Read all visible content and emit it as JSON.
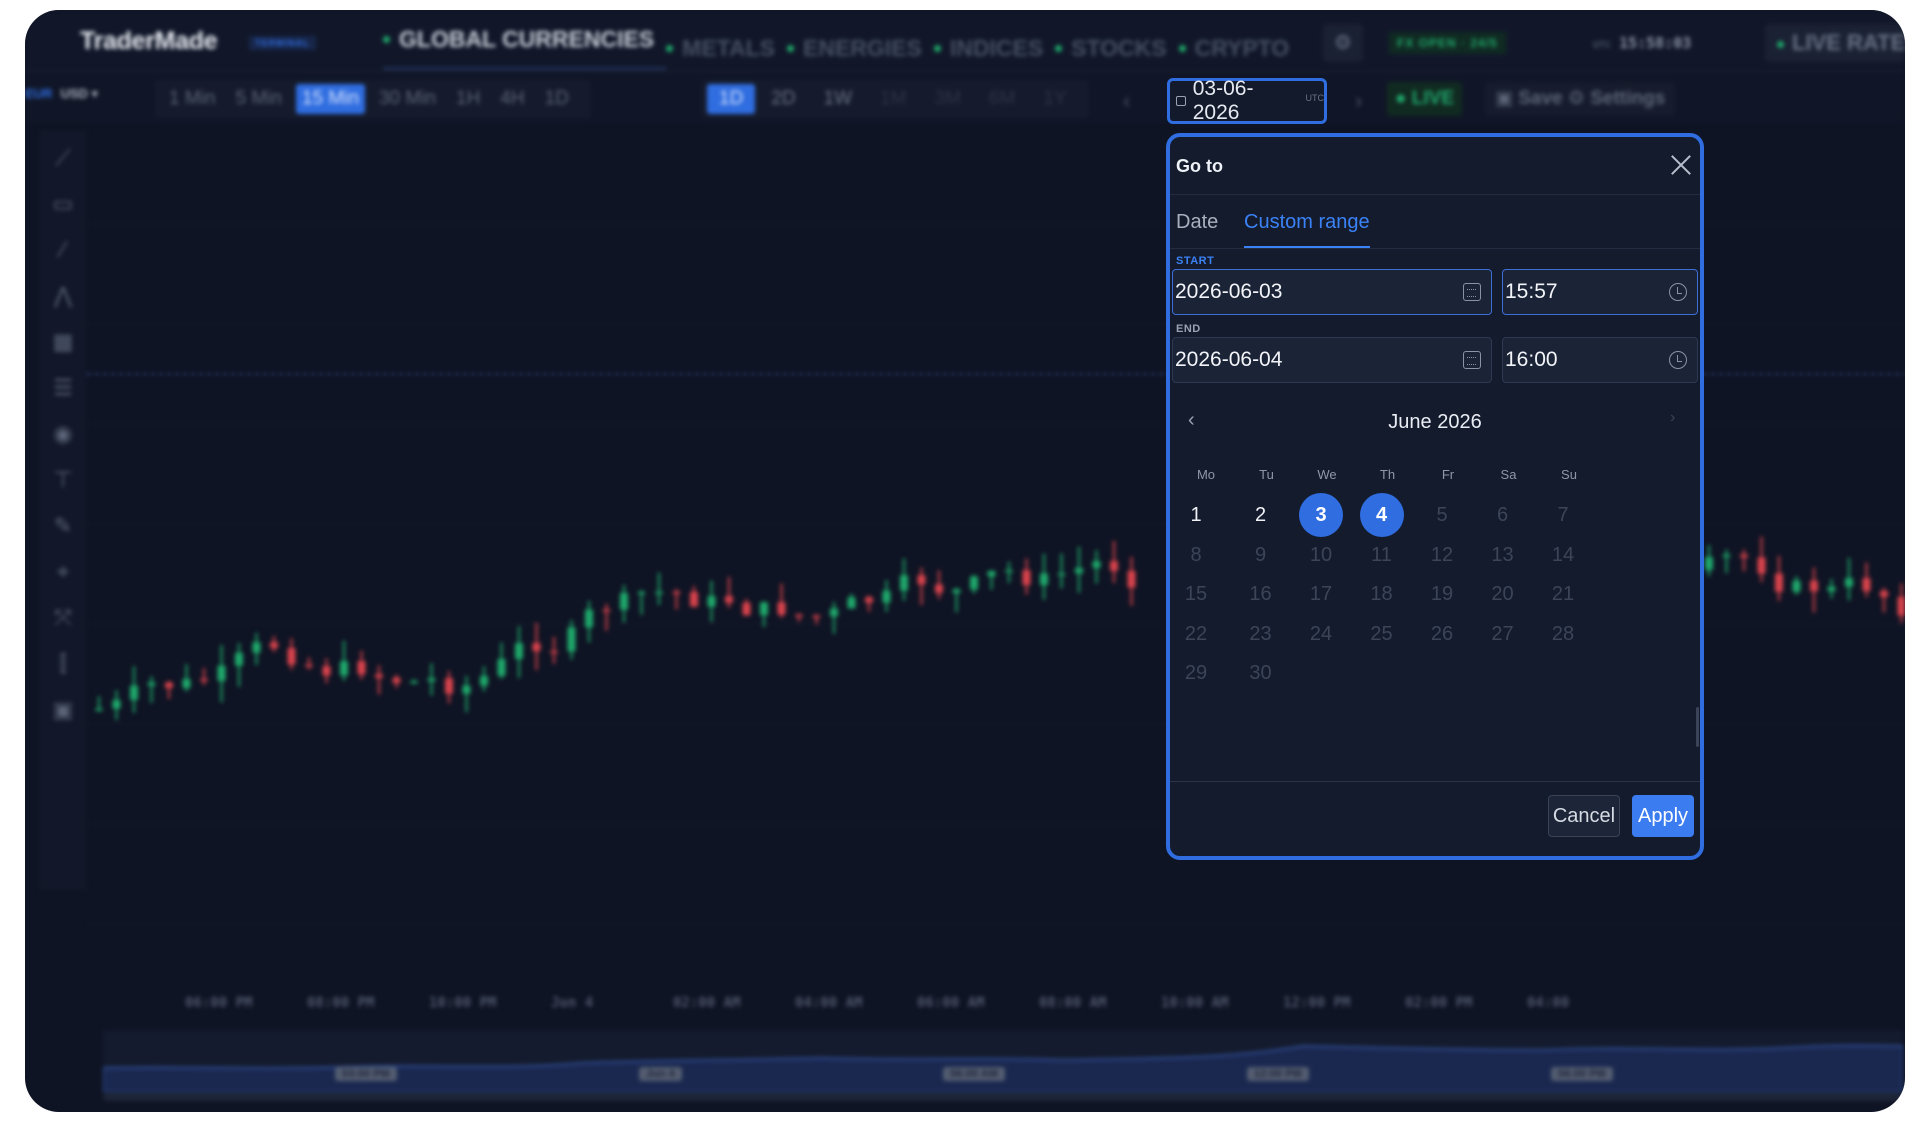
{
  "brand": {
    "name": "TraderMade",
    "badge": "TERMINAL"
  },
  "nav": [
    {
      "label": "GLOBAL CURRENCIES",
      "active": true
    },
    {
      "label": "METALS",
      "active": false
    },
    {
      "label": "ENERGIES",
      "active": false
    },
    {
      "label": "INDICES",
      "active": false
    },
    {
      "label": "STOCKS",
      "active": false
    },
    {
      "label": "CRYPTO",
      "active": false
    }
  ],
  "status": {
    "fx_open": "FX OPEN · 24/5",
    "tz": "UTC",
    "time": "15:58:03",
    "live_rates": "LIVE RATES"
  },
  "pair": {
    "base": "EUR",
    "quote": "USD"
  },
  "intervals": [
    "1 Min",
    "5 Min",
    "15 Min",
    "30 Min",
    "1H",
    "4H",
    "1D"
  ],
  "active_interval": "15 Min",
  "ranges": [
    "1D",
    "2D",
    "1W",
    "1M",
    "3M",
    "6M",
    "1Y"
  ],
  "active_range": "1D",
  "toolbar": {
    "live": "LIVE",
    "save_settings": "Save ⚙ Settings",
    "date": "03-06-2026",
    "date_tz": "UTC"
  },
  "x_axis_labels": [
    "06:00 PM",
    "08:00 PM",
    "10:00 PM",
    "Jun 4",
    "02:00 AM",
    "04:00 AM",
    "06:00 AM",
    "08:00 AM",
    "10:00 AM",
    "12:00 PM",
    "02:00 PM",
    "04:00"
  ],
  "navigator_labels": [
    "03:00 PM",
    "Jun 4",
    "06:00 AM",
    "12:00 PM",
    "06:00 PM"
  ],
  "dialog": {
    "title": "Go to",
    "tabs": [
      {
        "label": "Date",
        "active": false
      },
      {
        "label": "Custom range",
        "active": true
      }
    ],
    "start_label": "START",
    "start_date": "2026-06-03",
    "start_time": "15:57",
    "end_label": "END",
    "end_date": "2026-06-04",
    "end_time": "16:00",
    "month_label": "June 2026",
    "weekdays": [
      "Mo",
      "Tu",
      "We",
      "Th",
      "Fr",
      "Sa",
      "Su"
    ],
    "days": [
      1,
      2,
      3,
      4,
      5,
      6,
      7,
      8,
      9,
      10,
      11,
      12,
      13,
      14,
      15,
      16,
      17,
      18,
      19,
      20,
      21,
      22,
      23,
      24,
      25,
      26,
      27,
      28,
      29,
      30
    ],
    "available_days": [
      1,
      2,
      3,
      4
    ],
    "selected_days": [
      3,
      4
    ],
    "cancel": "Cancel",
    "apply": "Apply"
  },
  "colors": {
    "accent": "#2f6de0",
    "up": "#1fa86b",
    "down": "#d9434c",
    "bg": "#0f1424"
  },
  "sidebar_tools": [
    "trend-line-icon",
    "text-note-icon",
    "line-tool-icon",
    "pattern-icon",
    "grid-icon",
    "list-icon",
    "eye-icon",
    "measure-icon",
    "brush-icon",
    "ruler-icon",
    "shapes-icon",
    "indicator-icon",
    "trash-icon"
  ]
}
